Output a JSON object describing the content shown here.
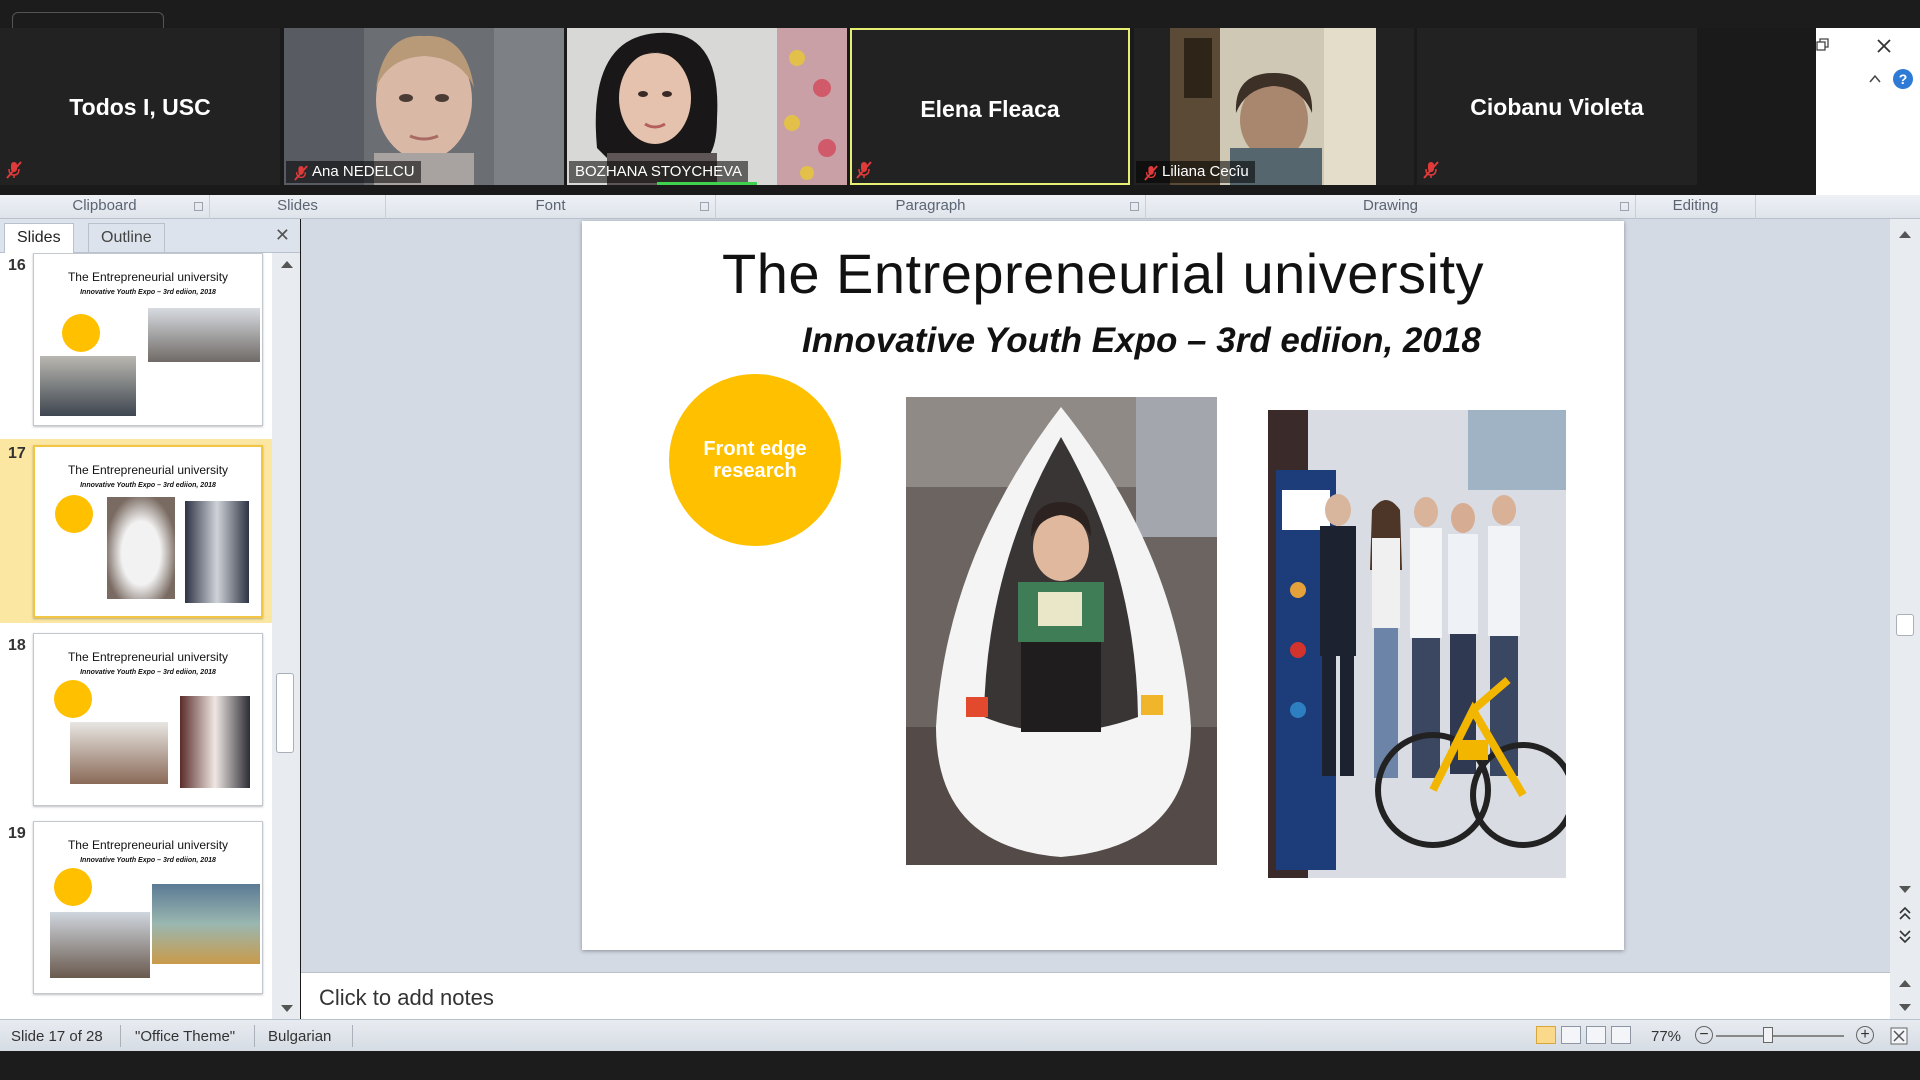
{
  "zoom": {
    "participants": [
      {
        "name": "Todos I, USC",
        "video": false,
        "muted": true
      },
      {
        "name": "Ana NEDELCU",
        "video": true,
        "muted": true
      },
      {
        "name": "BOZHANA STOYCHEVA",
        "video": true,
        "muted": false,
        "speaking": true
      },
      {
        "name": "Elena Fleaca",
        "video": false,
        "muted": true,
        "active": true
      },
      {
        "name": "Liliana Cecîu",
        "video": true,
        "muted": true
      },
      {
        "name": "Ciobanu Violeta",
        "video": false,
        "muted": true
      }
    ],
    "colors": {
      "active_border": "#e6ef74",
      "speaking": "#3fd24e",
      "muted_icon": "#e03a3a"
    }
  },
  "ribbon": {
    "groups": [
      "Clipboard",
      "Slides",
      "Font",
      "Paragraph",
      "Drawing",
      "Editing"
    ]
  },
  "slide_pane": {
    "tabs": [
      "Slides",
      "Outline"
    ],
    "active_tab": "Slides",
    "thumbnails": [
      {
        "number": "16",
        "title": "The Entrepreneurial university",
        "subtitle": "Innovative Youth Expo – 3rd ediion, 2018"
      },
      {
        "number": "17",
        "title": "The Entrepreneurial university",
        "subtitle": "Innovative Youth Expo – 3rd ediion, 2018",
        "selected": true
      },
      {
        "number": "18",
        "title": "The Entrepreneurial university",
        "subtitle": "Innovative Youth Expo – 3rd ediion, 2018"
      },
      {
        "number": "19",
        "title": "The Entrepreneurial university",
        "subtitle": "Innovative Youth Expo – 3rd ediion, 2018"
      }
    ]
  },
  "slide": {
    "title": "The Entrepreneurial university",
    "subtitle": "Innovative Youth Expo – 3rd ediion, 2018",
    "circle_text": "Front edge research",
    "colors": {
      "circle": "#ffc000"
    }
  },
  "notes": {
    "placeholder": "Click to add notes"
  },
  "status": {
    "slide_info": "Slide 17 of 28",
    "theme": "\"Office Theme\"",
    "language": "Bulgarian",
    "zoom": "77%"
  }
}
